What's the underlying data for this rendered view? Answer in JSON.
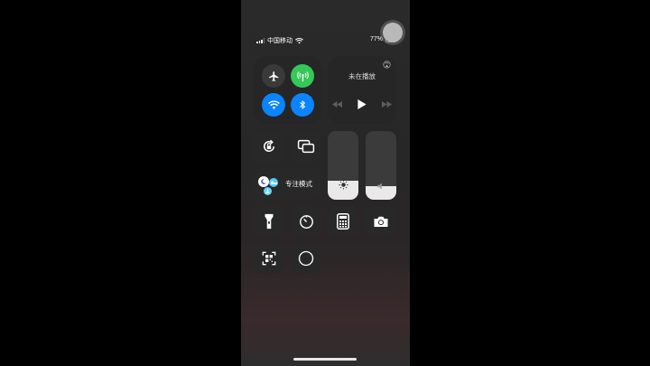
{
  "status_bar": {
    "carrier": "中国移动",
    "battery_percent": "77%",
    "battery_level": 0.77,
    "signal_icon": "signal-bars-icon",
    "wifi_icon": "wifi-icon"
  },
  "connectivity": {
    "airplane": {
      "icon": "airplane-icon",
      "state": "off"
    },
    "cellular": {
      "icon": "cellular-antenna-icon",
      "state": "on",
      "color": "#34c759"
    },
    "wifi": {
      "icon": "wifi-icon",
      "state": "on",
      "color": "#0a84ff"
    },
    "bluetooth": {
      "icon": "bluetooth-icon",
      "state": "on",
      "color": "#0a84ff"
    }
  },
  "media": {
    "title": "未在播放",
    "airplay_icon": "airplay-icon",
    "controls": [
      "rewind-icon",
      "play-icon",
      "fast-forward-icon"
    ]
  },
  "focus": {
    "label": "专注模式",
    "icons": [
      "moon-icon",
      "bed-icon",
      "person-icon"
    ]
  },
  "sliders": {
    "brightness": {
      "icon": "sun-icon",
      "level": 0.28
    },
    "volume": {
      "icon": "speaker-icon",
      "level": 0.2
    }
  },
  "tiles": {
    "orientation_lock": "orientation-lock-icon",
    "screen_mirroring": "screen-mirroring-icon",
    "flashlight": "flashlight-icon",
    "timer": "timer-icon",
    "calculator": "calculator-icon",
    "camera": "camera-icon",
    "qr_scanner": "qr-scanner-icon",
    "screen_record": "screen-record-icon"
  },
  "colors": {
    "accent_blue": "#0a84ff",
    "accent_green": "#34c759",
    "tile_bg": "#282828"
  }
}
